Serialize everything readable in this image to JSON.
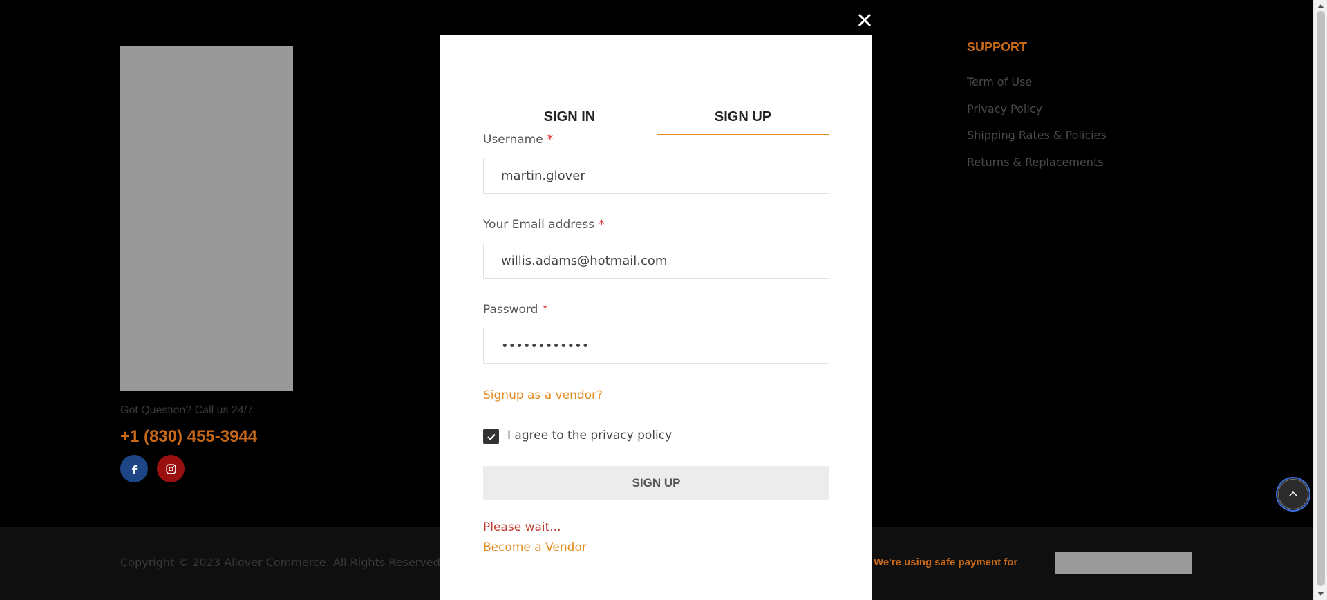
{
  "footer": {
    "question": "Got Question? Call us 24/7",
    "phone": "+1 (830) 455-3944",
    "social": [
      "facebook-icon",
      "instagram-icon"
    ],
    "support_title": "SUPPORT",
    "support_links": [
      "Term of Use",
      "Privacy Policy",
      "Shipping Rates & Policies",
      "Returns & Replacements"
    ],
    "copyright": "Copyright © 2023 Allover Commerce. All Rights Reserved.",
    "payment_text": "We're using safe payment for"
  },
  "modal": {
    "close_icon": "close-icon",
    "tabs": {
      "signin": "SIGN IN",
      "signup": "SIGN UP",
      "active": "signup"
    },
    "username_label": "Username",
    "username_value": "martin.glover",
    "email_label": "Your Email address",
    "email_value": "willis.adams@hotmail.com",
    "password_label": "Password",
    "password_value": "••••••••••••",
    "required_mark": "*",
    "vendor_link": "Signup as a vendor?",
    "agree_label": "I agree to the privacy policy",
    "agree_checked": true,
    "submit_label": "SIGN UP",
    "wait_text": "Please wait...",
    "become_vendor": "Become a Vendor"
  },
  "colors": {
    "accent": "#e08a1e",
    "footer_accent": "#c8691a",
    "required": "#e02020",
    "wait": "#c0392b"
  }
}
